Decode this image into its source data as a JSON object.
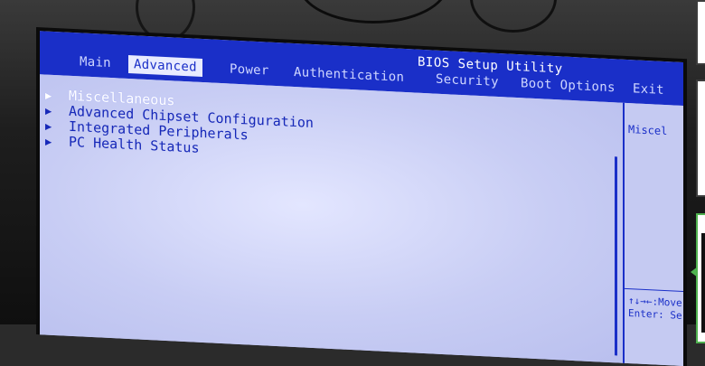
{
  "bios": {
    "title": "BIOS Setup Utility",
    "tabs": [
      {
        "label": "Main"
      },
      {
        "label": "Advanced"
      },
      {
        "label": "Power"
      },
      {
        "label": "Authentication"
      },
      {
        "label": "Security"
      },
      {
        "label": "Boot Options"
      },
      {
        "label": "Exit"
      }
    ],
    "active_tab": "Advanced",
    "menu": [
      {
        "label": "Miscellaneous",
        "selected": true
      },
      {
        "label": "Advanced Chipset Configuration",
        "selected": false
      },
      {
        "label": "Integrated Peripherals",
        "selected": false
      },
      {
        "label": "PC Health Status",
        "selected": false
      }
    ],
    "help": {
      "text": "Miscel",
      "key_hint_1": "↑↓→←:Move",
      "key_hint_2": "Enter: Se"
    },
    "arrow_glyph": "▶"
  },
  "colors": {
    "bar_blue": "#1a2fc8",
    "content_bg": "#c9cdf6",
    "active_tab_bg": "#e8ebff"
  }
}
